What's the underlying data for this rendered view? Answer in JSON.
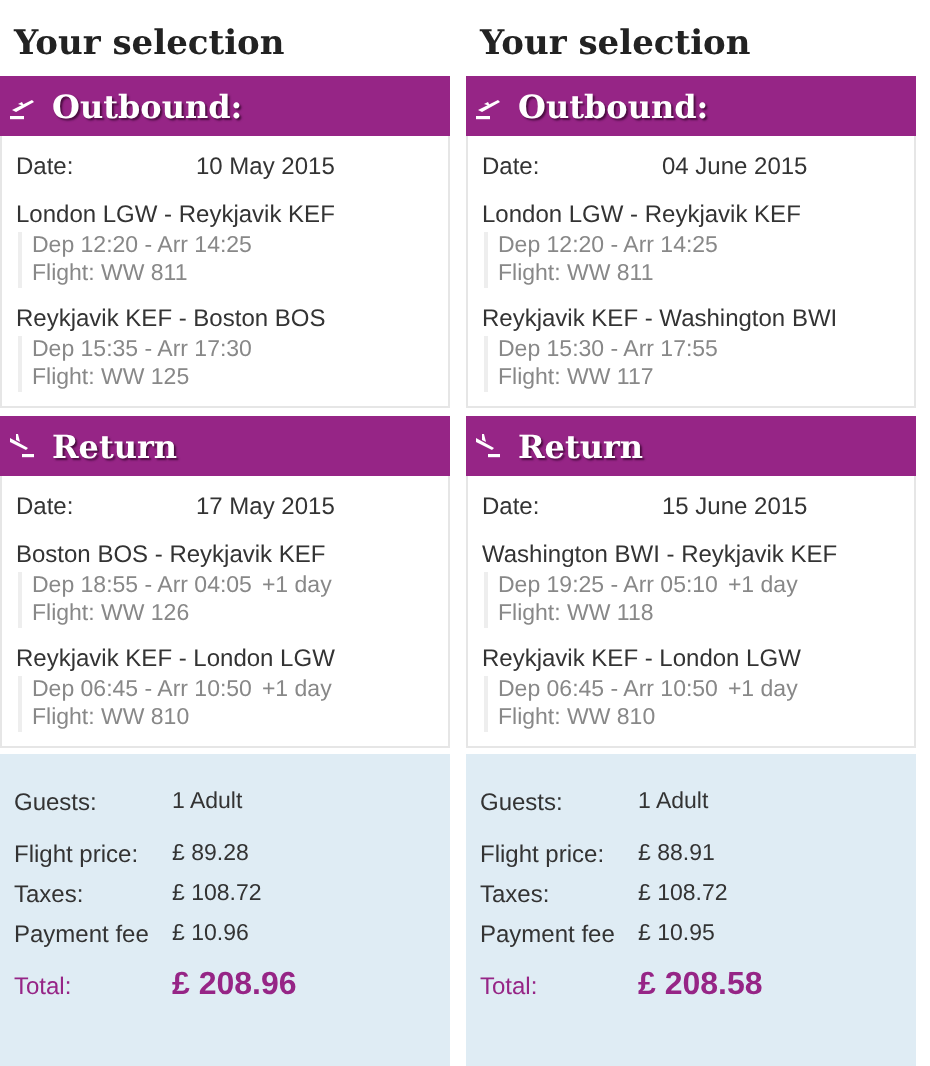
{
  "panels": [
    {
      "title": "Your selection",
      "sections": [
        {
          "kind": "outbound",
          "heading": "Outbound:",
          "date_label": "Date:",
          "date": "10 May 2015",
          "legs": [
            {
              "route": "London LGW - Reykjavik KEF",
              "times": "Dep 12:20 - Arr 14:25",
              "flight": "Flight: WW 811"
            },
            {
              "route": "Reykjavik KEF - Boston BOS",
              "times": "Dep 15:35 - Arr 17:30",
              "flight": "Flight: WW 125"
            }
          ]
        },
        {
          "kind": "return",
          "heading": "Return",
          "date_label": "Date:",
          "date": "17 May 2015",
          "legs": [
            {
              "route": "Boston BOS - Reykjavik KEF",
              "times": "Dep 18:55 - Arr 04:05",
              "extra": "+1 day",
              "flight": "Flight: WW 126"
            },
            {
              "route": "Reykjavik KEF - London LGW",
              "times": "Dep 06:45 - Arr 10:50",
              "extra": "+1 day",
              "flight": "Flight: WW 810"
            }
          ]
        }
      ],
      "summary": {
        "guests_label": "Guests:",
        "guests": "1 Adult",
        "rows": [
          {
            "label": "Flight price:",
            "value": "£ 89.28"
          },
          {
            "label": "Taxes:",
            "value": "£ 108.72"
          },
          {
            "label": "Payment fee",
            "value": "£ 10.96"
          }
        ],
        "total_label": "Total:",
        "total": "£ 208.96"
      }
    },
    {
      "title": "Your selection",
      "sections": [
        {
          "kind": "outbound",
          "heading": "Outbound:",
          "date_label": "Date:",
          "date": "04 June 2015",
          "legs": [
            {
              "route": "London LGW - Reykjavik KEF",
              "times": "Dep 12:20 - Arr 14:25",
              "flight": "Flight: WW 811"
            },
            {
              "route": "Reykjavik KEF - Washington BWI",
              "times": "Dep 15:30 - Arr 17:55",
              "flight": "Flight: WW 117"
            }
          ]
        },
        {
          "kind": "return",
          "heading": "Return",
          "date_label": "Date:",
          "date": "15 June 2015",
          "legs": [
            {
              "route": "Washington BWI - Reykjavik KEF",
              "times": "Dep 19:25 - Arr 05:10",
              "extra": "+1 day",
              "flight": "Flight: WW 118"
            },
            {
              "route": "Reykjavik KEF - London LGW",
              "times": "Dep 06:45 - Arr 10:50",
              "extra": "+1 day",
              "flight": "Flight: WW 810"
            }
          ]
        }
      ],
      "summary": {
        "guests_label": "Guests:",
        "guests": "1 Adult",
        "rows": [
          {
            "label": "Flight price:",
            "value": "£ 88.91"
          },
          {
            "label": "Taxes:",
            "value": "£ 108.72"
          },
          {
            "label": "Payment fee",
            "value": "£ 10.95"
          }
        ],
        "total_label": "Total:",
        "total": "£ 208.58"
      }
    }
  ]
}
